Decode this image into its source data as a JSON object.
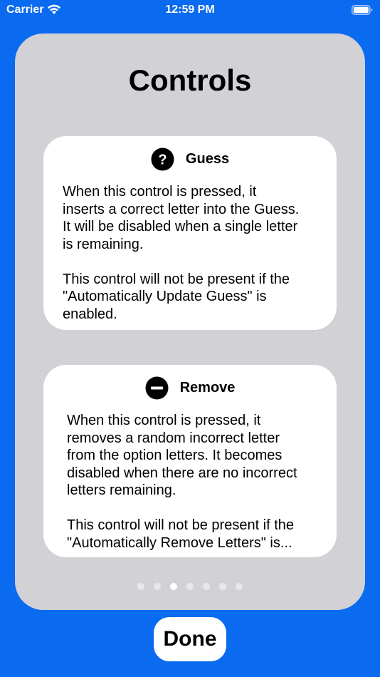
{
  "status_bar": {
    "carrier": "Carrier",
    "time": "12:59 PM",
    "wifi_icon": "wifi-icon",
    "battery_icon": "battery-icon"
  },
  "sheet": {
    "title": "Controls"
  },
  "cards": [
    {
      "icon": "question-circle-icon",
      "title": "Guess",
      "body": "When this control is  pressed, it\ninserts a correct letter into the Guess.\nIt will be disabled when a single letter\nis remaining.\n\nThis control will not be present if the\n\"Automatically Update Guess\" is\nenabled."
    },
    {
      "icon": "minus-circle-icon",
      "title": "Remove",
      "body": "When this control is  pressed, it\nremoves a random incorrect letter\nfrom the option letters. It becomes\ndisabled when there are no incorrect\nletters remaining.\n\nThis control will not be present if the\n\"Automatically Remove Letters\" is..."
    }
  ],
  "pagination": {
    "total": 7,
    "current": 3
  },
  "done_button": {
    "label": "Done"
  },
  "colors": {
    "background": "#0a6af0",
    "sheet": "#d1d1d6",
    "card": "#ffffff"
  }
}
